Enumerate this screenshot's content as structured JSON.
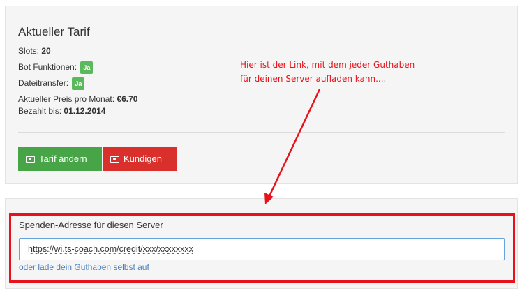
{
  "tariff": {
    "title": "Aktueller Tarif",
    "slots_label": "Slots:",
    "slots_value": "20",
    "bot_label": "Bot Funktionen:",
    "bot_badge": "Ja",
    "file_label": "Dateitransfer:",
    "file_badge": "Ja",
    "price_label": "Aktueller Preis pro Monat:",
    "price_value": "€6.70",
    "paid_label": "Bezahlt bis:",
    "paid_value": "01.12.2014",
    "change_button": "Tarif ändern",
    "cancel_button": "Kündigen"
  },
  "annotation": {
    "line1": "Hier ist der Link, mit dem jeder Guthaben",
    "line2": "für deinen Server aufladen kann...."
  },
  "donate": {
    "label": "Spenden-Adresse für diesen Server",
    "url": "https://wi.ts-coach.com/credit/xxx/xxxxxxxx",
    "self_link": "oder lade dein Guthaben selbst auf"
  },
  "colors": {
    "green": "#47a447",
    "red": "#d9302b",
    "annotation_red": "#e8131a",
    "link": "#4a7fbf"
  },
  "icons": {
    "button_icon": "money-icon"
  }
}
